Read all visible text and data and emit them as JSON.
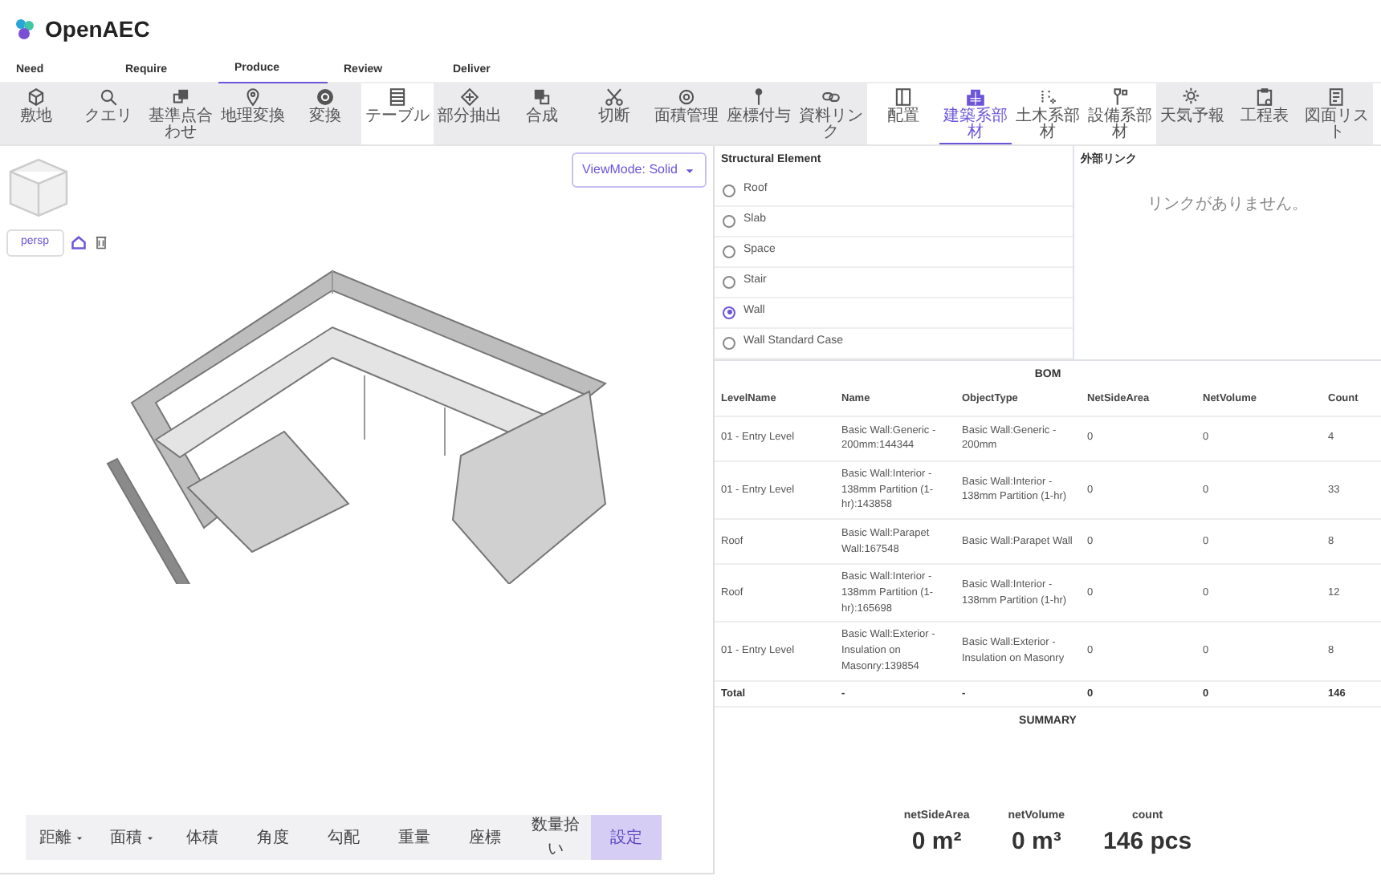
{
  "app": {
    "title": "OpenAEC"
  },
  "tabs": [
    {
      "label": "Need",
      "selected": false
    },
    {
      "label": "Require",
      "selected": false
    },
    {
      "label": "Produce",
      "selected": true
    },
    {
      "label": "Review",
      "selected": false
    },
    {
      "label": "Deliver",
      "selected": false
    }
  ],
  "toolbar": [
    {
      "shaded": true,
      "items": [
        {
          "label": "敷地",
          "selected": false
        },
        {
          "label": "クエリ",
          "selected": false
        },
        {
          "label": "基準点合わせ",
          "selected": false
        },
        {
          "label": "地理変換",
          "selected": false
        },
        {
          "label": "変換",
          "selected": false
        }
      ]
    },
    {
      "shaded": false,
      "items": [
        {
          "label": "テーブル",
          "selected": false
        }
      ]
    },
    {
      "shaded": true,
      "items": [
        {
          "label": "部分抽出",
          "selected": false
        },
        {
          "label": "合成",
          "selected": false
        },
        {
          "label": "切断",
          "selected": false
        },
        {
          "label": "面積管理",
          "selected": false
        },
        {
          "label": "座標付与",
          "selected": false
        },
        {
          "label": "資料リンク",
          "selected": false
        }
      ]
    },
    {
      "shaded": false,
      "items": [
        {
          "label": "配置",
          "selected": false
        },
        {
          "label": "建築系部材",
          "selected": true
        },
        {
          "label": "土木系部材",
          "selected": false
        },
        {
          "label": "設備系部材",
          "selected": false
        }
      ]
    },
    {
      "shaded": true,
      "items": [
        {
          "label": "天気予報",
          "selected": false
        },
        {
          "label": "工程表",
          "selected": false
        },
        {
          "label": "図面リスト",
          "selected": false
        }
      ]
    }
  ],
  "viewer": {
    "camera_button": "persp",
    "view_mode": "ViewMode: Solid",
    "measure_tools": [
      {
        "label": "距離",
        "dropdown": true,
        "selected": false
      },
      {
        "label": "面積",
        "dropdown": true,
        "selected": false
      },
      {
        "label": "体積",
        "dropdown": false,
        "selected": false
      },
      {
        "label": "角度",
        "dropdown": false,
        "selected": false
      },
      {
        "label": "勾配",
        "dropdown": false,
        "selected": false
      },
      {
        "label": "重量",
        "dropdown": false,
        "selected": false
      },
      {
        "label": "座標",
        "dropdown": false,
        "selected": false
      },
      {
        "label": "数量拾い",
        "dropdown": false,
        "selected": false
      },
      {
        "label": "設定",
        "dropdown": false,
        "selected": true
      }
    ]
  },
  "structural_element": {
    "title": "Structural Element",
    "options": [
      {
        "label": "Roof",
        "selected": false
      },
      {
        "label": "Slab",
        "selected": false
      },
      {
        "label": "Space",
        "selected": false
      },
      {
        "label": "Stair",
        "selected": false
      },
      {
        "label": "Wall",
        "selected": true
      },
      {
        "label": "Wall Standard Case",
        "selected": false
      }
    ]
  },
  "external_links": {
    "title": "外部リンク",
    "empty_message": "リンクがありません。"
  },
  "bom": {
    "title": "BOM",
    "columns": [
      "LevelName",
      "Name",
      "ObjectType",
      "NetSideArea",
      "NetVolume",
      "Count"
    ],
    "rows": [
      [
        "01 - Entry Level",
        "Basic Wall:Generic - 200mm:144344",
        "Basic Wall:Generic - 200mm",
        "0",
        "0",
        "4"
      ],
      [
        "01 - Entry Level",
        "Basic Wall:Interior - 138mm Partition (1-hr):143858",
        "Basic Wall:Interior - 138mm Partition (1-hr)",
        "0",
        "0",
        "33"
      ],
      [
        "Roof",
        "Basic Wall:Parapet Wall:167548",
        "Basic Wall:Parapet Wall",
        "0",
        "0",
        "8"
      ],
      [
        "Roof",
        "Basic Wall:Interior - 138mm Partition (1-hr):165698",
        "Basic Wall:Interior - 138mm Partition (1-hr)",
        "0",
        "0",
        "12"
      ],
      [
        "01 - Entry Level",
        "Basic Wall:Exterior - Insulation on Masonry:139854",
        "Basic Wall:Exterior - Insulation on Masonry",
        "0",
        "0",
        "8"
      ]
    ],
    "total": [
      "Total",
      "-",
      "-",
      "0",
      "0",
      "146"
    ]
  },
  "summary": {
    "title": "SUMMARY",
    "metrics": [
      {
        "label": "netSideArea",
        "value": "0 m²"
      },
      {
        "label": "netVolume",
        "value": "0 m³"
      },
      {
        "label": "count",
        "value": "146 pcs"
      }
    ]
  }
}
